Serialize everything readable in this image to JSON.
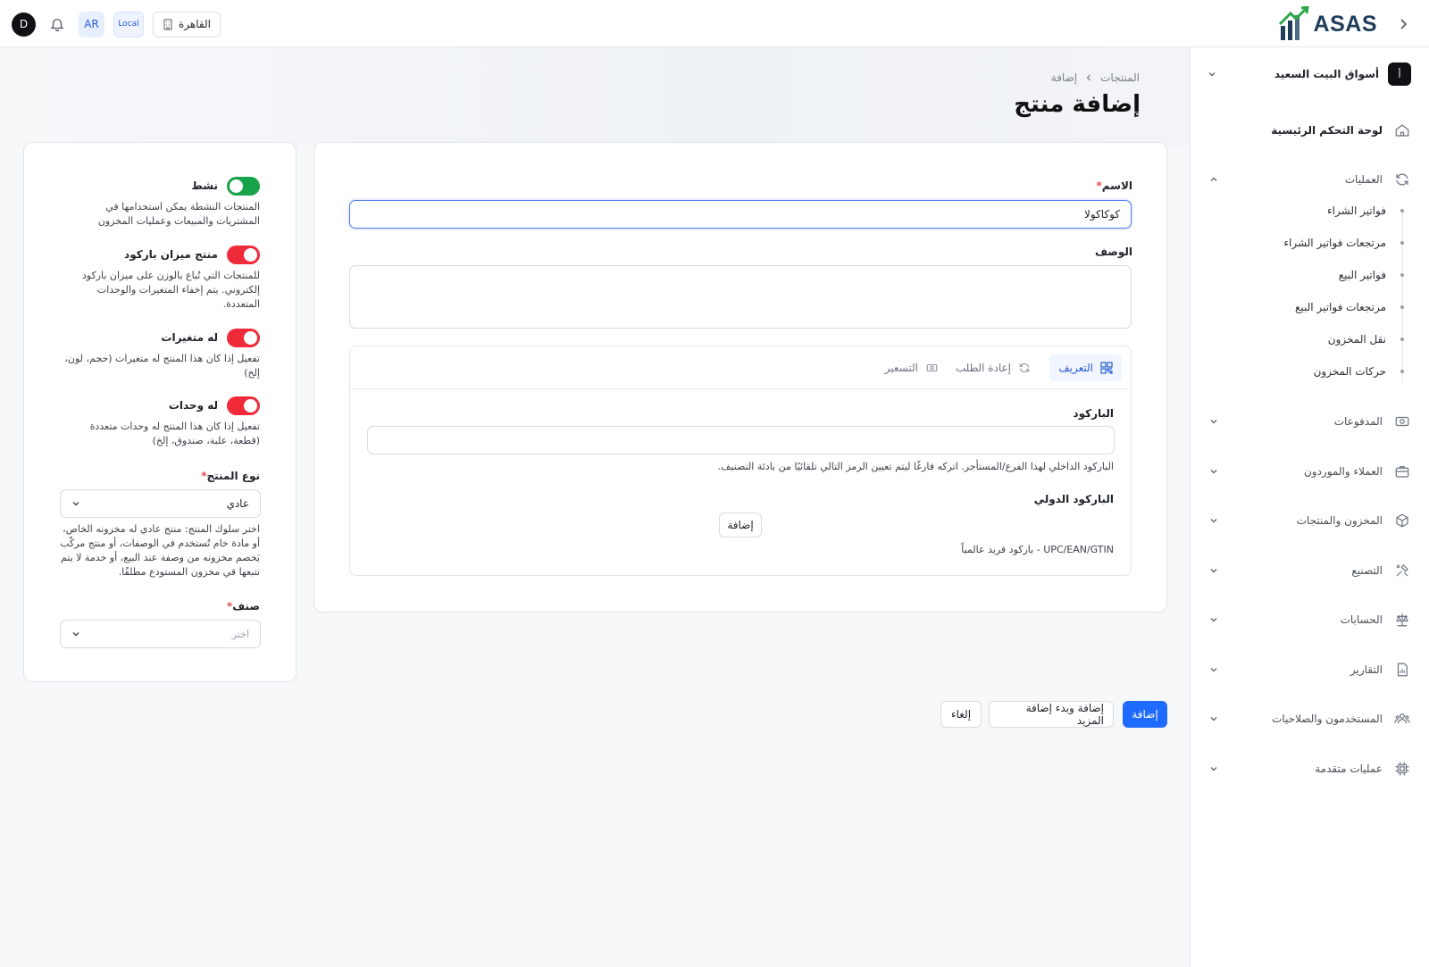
{
  "topbar": {
    "avatar_initial": "D",
    "language": "AR",
    "local_label": "Local",
    "city": "القاهرة",
    "brand": "ASAS"
  },
  "sidebar": {
    "store_icon": "أ",
    "store_name": "أسواق البيت السعيد",
    "items": [
      {
        "label": "لوحة التحكم الرئيسية",
        "icon": "home-icon"
      },
      {
        "label": "العمليات",
        "icon": "refresh-icon",
        "expanded": true,
        "children": [
          "فواتير الشراء",
          "مرتجعات فواتير الشراء",
          "فواتير البيع",
          "مرتجعات فواتير البيع",
          "نقل المخزون",
          "حركات المخزون"
        ]
      },
      {
        "label": "المدفوعات",
        "icon": "money-icon"
      },
      {
        "label": "العملاء والموردون",
        "icon": "briefcase-icon"
      },
      {
        "label": "المخزون والمنتجات",
        "icon": "box-icon"
      },
      {
        "label": "التصنيع",
        "icon": "tools-icon"
      },
      {
        "label": "الحسابات",
        "icon": "scale-icon"
      },
      {
        "label": "التقارير",
        "icon": "report-icon"
      },
      {
        "label": "المستخدمون والصلاحيات",
        "icon": "users-icon"
      },
      {
        "label": "عمليات متقدمة",
        "icon": "chip-icon"
      }
    ]
  },
  "breadcrumb": {
    "parent": "المنتجات",
    "current": "إضافة"
  },
  "page_title": "إضافة منتج",
  "form": {
    "name_label": "الاسم",
    "name_value": "كوكاكولا",
    "description_label": "الوصف",
    "description_value": "",
    "tabs": [
      {
        "label": "التعريف",
        "icon": "qr-icon",
        "active": true
      },
      {
        "label": "إعادة الطلب",
        "icon": "refresh-icon",
        "active": false
      },
      {
        "label": "التسعير",
        "icon": "money-icon",
        "active": false
      }
    ],
    "barcode_label": "الباركود",
    "barcode_value": "",
    "barcode_help": "الباركود الداخلي لهذا الفرع/المستأجر. اتركه فارغًا ليتم تعيين الرمز التالي تلقائيًا من بادئة التصنيف.",
    "intl_barcode_label": "الباركود الدولي",
    "intl_add_label": "إضافة",
    "intl_help": "UPC/EAN/GTIN - باركود فريد عالمياً"
  },
  "settings": {
    "active": {
      "title": "نشط",
      "on": true,
      "help": "المنتجات النشطة يمكن استخدامها في المشتريات والمبيعات وعمليات المخزون"
    },
    "scale": {
      "title": "منتج ميزان باركود",
      "on": false,
      "help": "للمنتجات التي تُباع بالوزن على ميزان باركود إلكتروني. يتم إخفاء المتغيرات والوحدات المتعددة."
    },
    "variants": {
      "title": "له متغيرات",
      "on": false,
      "help": "تفعيل إذا كان هذا المنتج له متغيرات (حجم، لون، إلخ)"
    },
    "units": {
      "title": "له وحدات",
      "on": false,
      "help": "تفعيل إذا كان هذا المنتج له وحدات متعددة (قطعة، علبة، صندوق، إلخ)"
    },
    "product_type_label": "نوع المنتج",
    "product_type_value": "عادي",
    "product_type_help": "اختر سلوك المنتج: منتج عادي له مخزونه الخاص، أو مادة خام تُستخدم في الوصفات، أو منتج مركّب يَخصم مخزونه من وصفة عند البيع، أو خدمة لا يتم تتبعها في مخزون المستودع مطلقًا.",
    "category_label": "صنف",
    "category_placeholder": "اختر"
  },
  "actions": {
    "submit": "إضافة",
    "submit_more": "إضافة وبدء إضافة المزيد",
    "cancel": "إلغاء"
  },
  "colors": {
    "primary": "#1f6bff",
    "toggle_on": "#16a34a",
    "toggle_off": "#ef2b3a",
    "brand": "#1f3d5a"
  }
}
